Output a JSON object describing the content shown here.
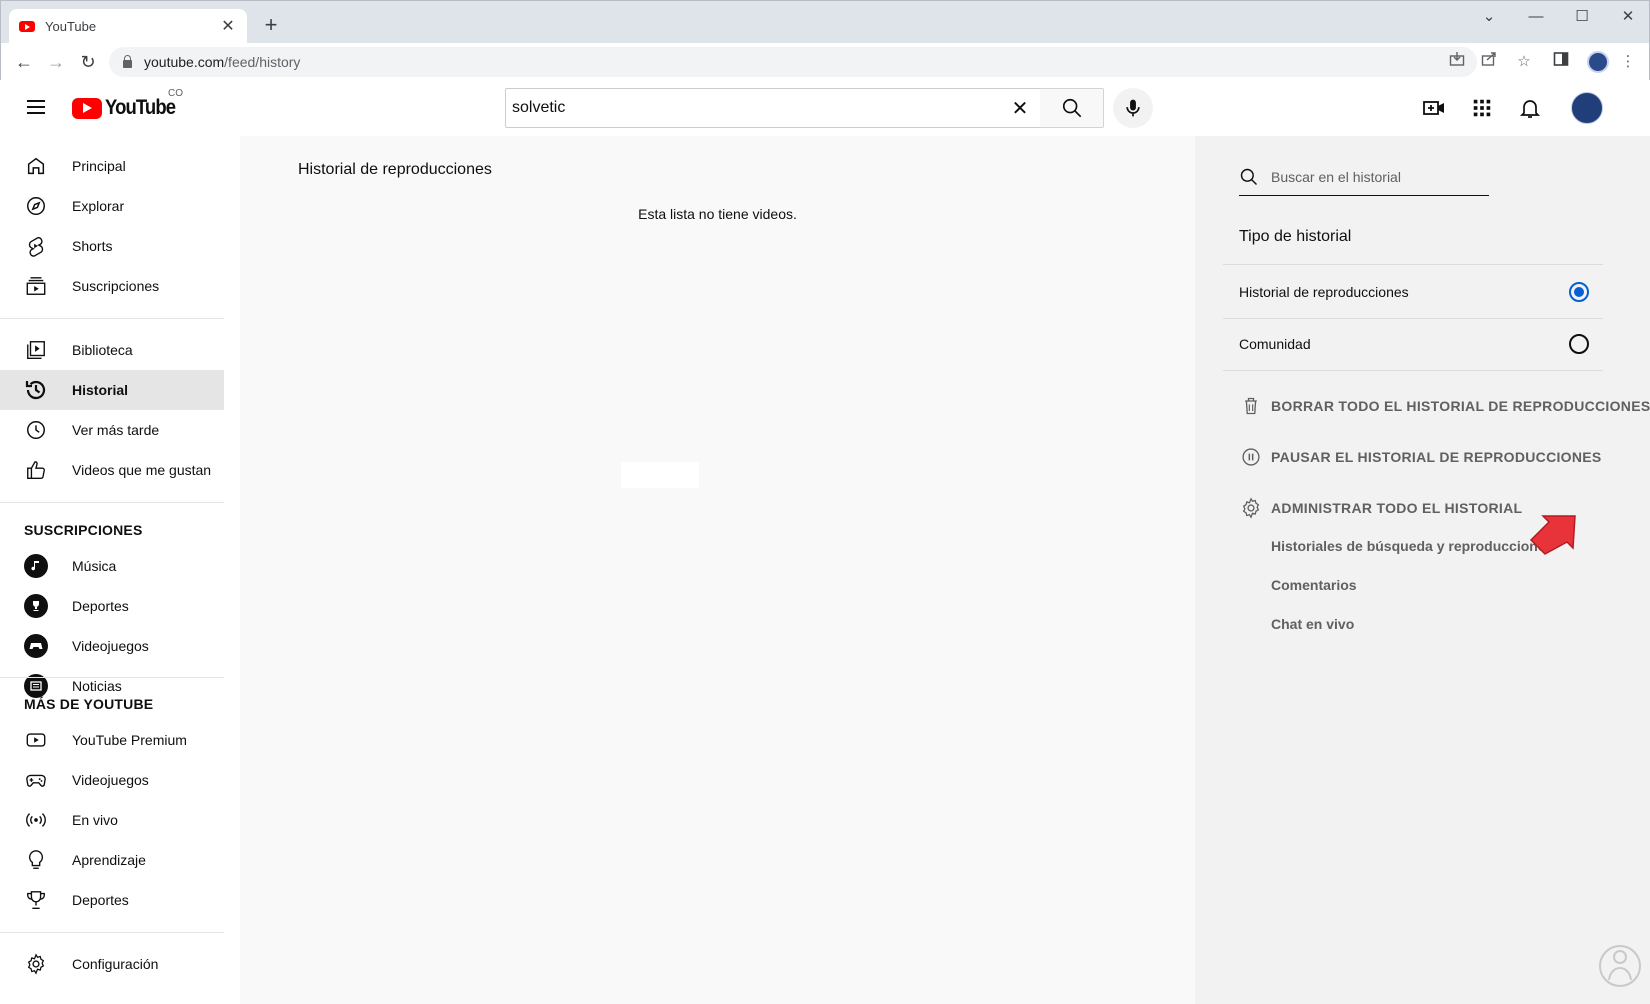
{
  "browser": {
    "tab_title": "YouTube",
    "tab_close": "✕",
    "new_tab": "+",
    "url_host": "youtube.com",
    "url_path": "/feed/history"
  },
  "header": {
    "logo_text": "YouTube",
    "region": "CO",
    "search_value": "solvetic",
    "search_clear": "✕"
  },
  "guide": {
    "primary": [
      {
        "label": "Principal",
        "icon": "home-icon"
      },
      {
        "label": "Explorar",
        "icon": "compass-icon"
      },
      {
        "label": "Shorts",
        "icon": "shorts-icon"
      },
      {
        "label": "Suscripciones",
        "icon": "subscriptions-icon"
      }
    ],
    "library": [
      {
        "label": "Biblioteca",
        "icon": "library-icon"
      },
      {
        "label": "Historial",
        "icon": "history-icon",
        "active": true
      },
      {
        "label": "Ver más tarde",
        "icon": "clock-icon"
      },
      {
        "label": "Videos que me gustan",
        "icon": "thumbs-up-icon"
      }
    ],
    "subscriptions_heading": "SUSCRIPCIONES",
    "subscriptions": [
      {
        "label": "Música",
        "icon": "music-channel-icon"
      },
      {
        "label": "Deportes",
        "icon": "sports-channel-icon"
      },
      {
        "label": "Videojuegos",
        "icon": "gaming-channel-icon"
      },
      {
        "label": "Noticias",
        "icon": "news-channel-icon"
      }
    ],
    "more_heading": "MÁS DE YOUTUBE",
    "more": [
      {
        "label": "YouTube Premium",
        "icon": "youtube-premium-icon"
      },
      {
        "label": "Videojuegos",
        "icon": "gamepad-icon"
      },
      {
        "label": "En vivo",
        "icon": "live-icon"
      },
      {
        "label": "Aprendizaje",
        "icon": "lightbulb-icon"
      },
      {
        "label": "Deportes",
        "icon": "trophy-icon"
      }
    ],
    "settings": {
      "label": "Configuración",
      "icon": "gear-icon"
    }
  },
  "main": {
    "title": "Historial de reproducciones",
    "empty_message": "Esta lista no tiene videos."
  },
  "panel": {
    "search_placeholder": "Buscar en el historial",
    "type_heading": "Tipo de historial",
    "options": [
      {
        "label": "Historial de reproducciones",
        "selected": true
      },
      {
        "label": "Comunidad",
        "selected": false
      }
    ],
    "actions": {
      "clear": "BORRAR TODO EL HISTORIAL DE REPRODUCCIONES",
      "pause": "PAUSAR EL HISTORIAL DE REPRODUCCIONES",
      "manage": "ADMINISTRAR TODO EL HISTORIAL"
    },
    "sublinks": [
      "Historiales de búsqueda y reproducciones",
      "Comentarios",
      "Chat en vivo"
    ]
  },
  "colors": {
    "accent": "#065fd4",
    "brand_red": "#ff0000",
    "annotation_arrow": "#e8333a"
  }
}
